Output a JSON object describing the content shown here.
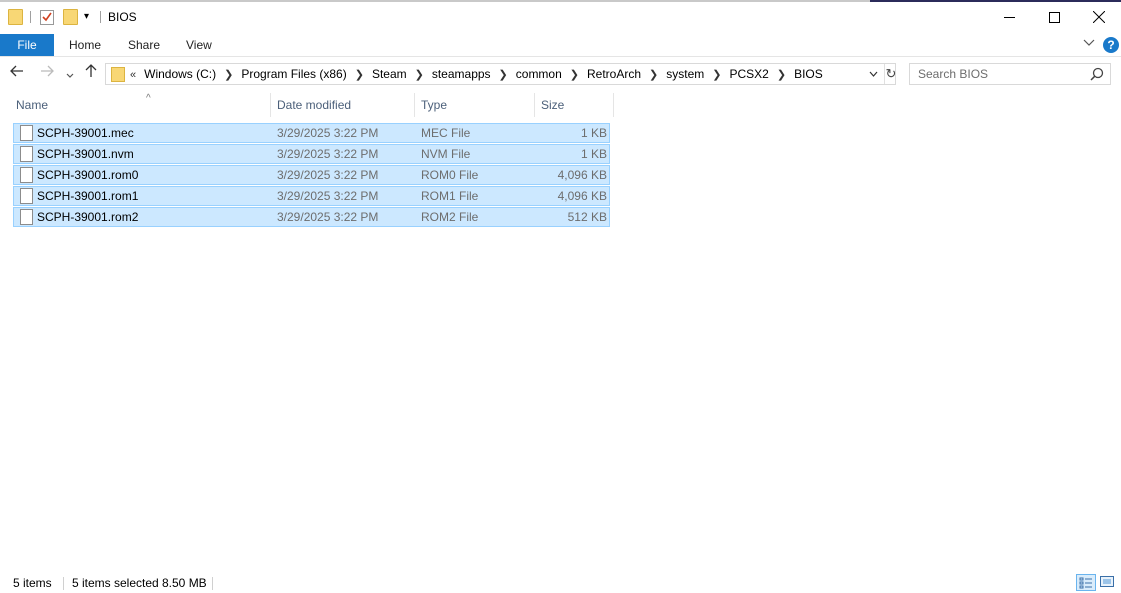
{
  "window": {
    "title": "BIOS",
    "controls": [
      "minimize",
      "maximize",
      "close"
    ]
  },
  "ribbon": {
    "tabs": [
      {
        "label": "File",
        "active": true
      },
      {
        "label": "Home"
      },
      {
        "label": "Share"
      },
      {
        "label": "View"
      }
    ]
  },
  "address": {
    "overflow": "«",
    "crumbs": [
      "Windows (C:)",
      "Program Files (x86)",
      "Steam",
      "steamapps",
      "common",
      "RetroArch",
      "system",
      "PCSX2",
      "BIOS"
    ]
  },
  "search": {
    "placeholder": "Search BIOS"
  },
  "columns": {
    "name": "Name",
    "date": "Date modified",
    "type": "Type",
    "size": "Size"
  },
  "files": [
    {
      "name": "SCPH-39001.mec",
      "date": "3/29/2025 3:22 PM",
      "type": "MEC File",
      "size": "1 KB"
    },
    {
      "name": "SCPH-39001.nvm",
      "date": "3/29/2025 3:22 PM",
      "type": "NVM File",
      "size": "1 KB"
    },
    {
      "name": "SCPH-39001.rom0",
      "date": "3/29/2025 3:22 PM",
      "type": "ROM0 File",
      "size": "4,096 KB"
    },
    {
      "name": "SCPH-39001.rom1",
      "date": "3/29/2025 3:22 PM",
      "type": "ROM1 File",
      "size": "4,096 KB"
    },
    {
      "name": "SCPH-39001.rom2",
      "date": "3/29/2025 3:22 PM",
      "type": "ROM2 File",
      "size": "512 KB"
    }
  ],
  "status": {
    "item_count": "5 items",
    "selected": "5 items selected",
    "selected_size": "8.50 MB"
  },
  "colors": {
    "accent": "#1979ca",
    "selection": "#cce8ff",
    "selection_border": "#99d1ff"
  }
}
